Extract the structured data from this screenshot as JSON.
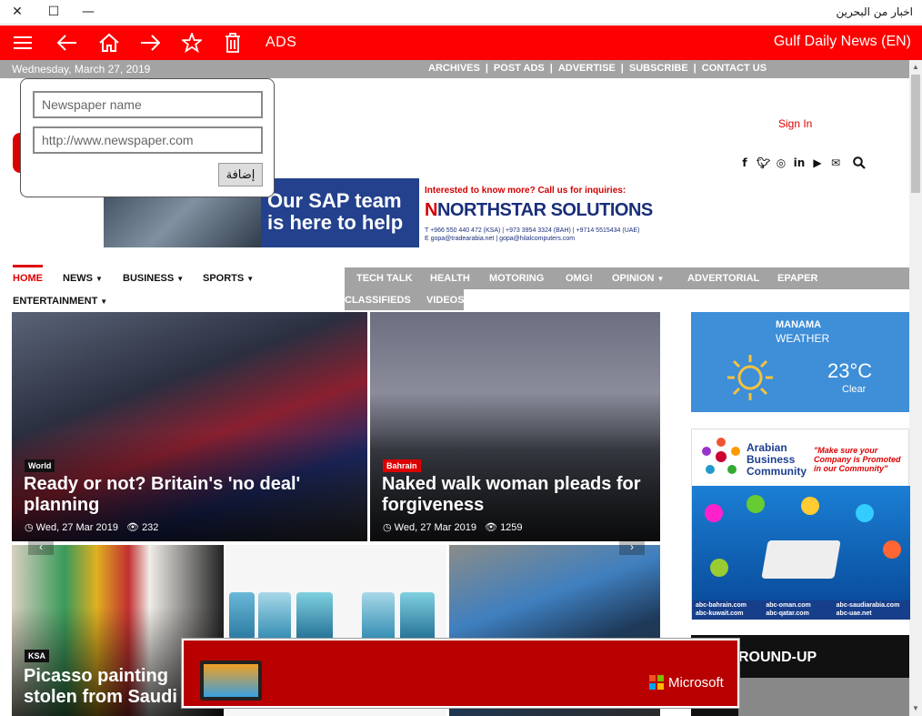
{
  "titlebar": {
    "close": "✕",
    "maximize": "☐",
    "minimize": "—",
    "title": "اخبار من البحرين"
  },
  "appbar": {
    "ads_label": "ADS",
    "app_title": "Gulf Daily News (EN)"
  },
  "topstrip": {
    "date": "Wednesday, March 27, 2019",
    "links": [
      "ARCHIVES",
      "POST ADS",
      "ADVERTISE",
      "SUBSCRIBE",
      "CONTACT US"
    ]
  },
  "popup": {
    "name_placeholder": "Newspaper name",
    "url_placeholder": "http://www.newspaper.com",
    "add_label": "إضافة"
  },
  "header": {
    "signin": "Sign In"
  },
  "banner": {
    "headline_line1": "Our SAP team",
    "headline_line2": "is here to help",
    "question": "Interested to know more? Call us for inquiries:",
    "brand_mark": "N",
    "brand": "NORTHSTAR SOLUTIONS",
    "contact1": "T +966 550 440 472 (KSA) | +973 3954 3324 (BAH) | +9714 5515434 (UAE)",
    "contact2": "E gopa@tradearabia.net | gopa@hilalcomputers.com"
  },
  "nav": {
    "home": "HOME",
    "news": "NEWS",
    "business": "BUSINESS",
    "sports": "SPORTS",
    "entertainment": "ENTERTAINMENT",
    "tech_talk": "TECH TALK",
    "health": "HEALTH",
    "motoring": "MOTORING",
    "omg": "OMG!",
    "opinion": "OPINION",
    "advertorial": "ADVERTORIAL",
    "epaper": "EPAPER",
    "classifieds": "CLASSIFIEDS",
    "videos": "VIDEOS"
  },
  "articles": [
    {
      "category": "World",
      "headline_l1": "Ready or not? Britain's 'no deal'",
      "headline_l2": "planning",
      "date": "Wed, 27 Mar 2019",
      "views": "232"
    },
    {
      "category": "Bahrain",
      "headline_l1": "Naked walk woman pleads for",
      "headline_l2": "forgiveness",
      "date": "Wed, 27 Mar 2019",
      "views": "1259"
    },
    {
      "category": "KSA",
      "headline_l1": "Picasso painting",
      "headline_l2": "stolen from Saudi"
    }
  ],
  "weather": {
    "city": "MANAMA",
    "label": "WEATHER",
    "temp": "23°C",
    "desc": "Clear"
  },
  "abc": {
    "name_l1": "Arabian",
    "name_l2": "Business",
    "name_l3": "Community",
    "quote_l1": "\"Make sure your",
    "quote_l2": "Company is Promoted",
    "quote_l3": "in our Community\"",
    "domains": [
      "abc-bahrain.com",
      "abc-oman.com",
      "abc-saudiarabia.com",
      "abc-kuwait.com",
      "abc-qatar.com",
      "abc-uae.net"
    ]
  },
  "roundup": {
    "title": "ROUND-UP"
  },
  "msad": {
    "brand": "Microsoft",
    "colors": [
      "#f25022",
      "#7fba00",
      "#00a4ef",
      "#ffb900"
    ]
  },
  "colors": {
    "accent": "#ff0000",
    "strip": "#a3a3a3",
    "nav_active": "#e00000"
  }
}
